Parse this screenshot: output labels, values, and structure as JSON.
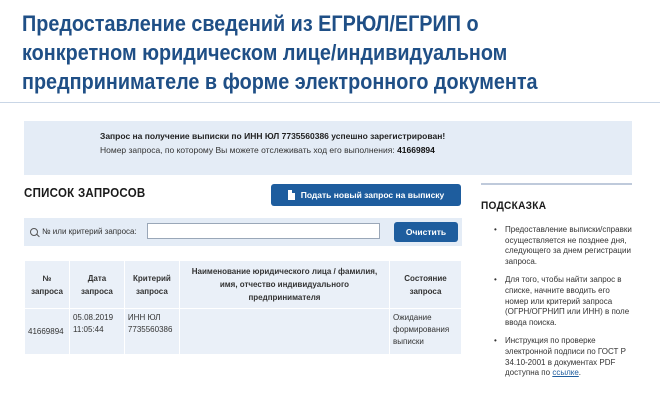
{
  "header": {
    "title": "Предоставление сведений из ЕГРЮЛ/ЕГРИП о конкретном юридическом лице/индивидуальном предпринимателе в форме электронного документа"
  },
  "notice": {
    "line1": "Запрос на получение выписки по ИНН ЮЛ 7735560386 успешно зарегистрирован!",
    "line2_prefix": "Номер запроса, по которому Вы можете отслеживать ход его выполнения:",
    "request_number": "41669894"
  },
  "requests": {
    "section_title": "СПИСОК ЗАПРОСОВ",
    "new_request_button": "Подать новый запрос на выписку",
    "search_label": "№ или критерий запроса:",
    "search_value": "",
    "clear_button": "Очистить",
    "columns": [
      "№ запроса",
      "Дата запроса",
      "Критерий запроса",
      "Наименование юридического лица / фамилия, имя, отчество индивидуального предпринимателя",
      "Состояние запроса"
    ],
    "rows": [
      {
        "number": "41669894",
        "date": "05.08.2019 11:05:44",
        "criterion": "ИНН ЮЛ 7735560386",
        "name": "",
        "status": "Ожидание формирования выписки"
      }
    ]
  },
  "sidebar": {
    "title": "ПОДСКАЗКА",
    "hints": [
      "Предоставление выписки/справки осуществляется не позднее дня, следующего за днем регистрации запроса.",
      "Для того, чтобы найти запрос в списке, начните вводить его номер или критерий запроса (ОГРН/ОГРНИП или ИНН) в поле ввода поиска."
    ],
    "hint3_text": "Инструкция по проверке электронной подписи по ГОСТ Р 34.10-2001 в документах PDF доступна по",
    "hint3_link": "ссылке",
    "hint3_end": "."
  },
  "colors": {
    "title": "#1f4f86",
    "button": "#1e5d9e",
    "panel": "#e4ecf6"
  },
  "icons": [
    "search-icon",
    "document-icon"
  ]
}
